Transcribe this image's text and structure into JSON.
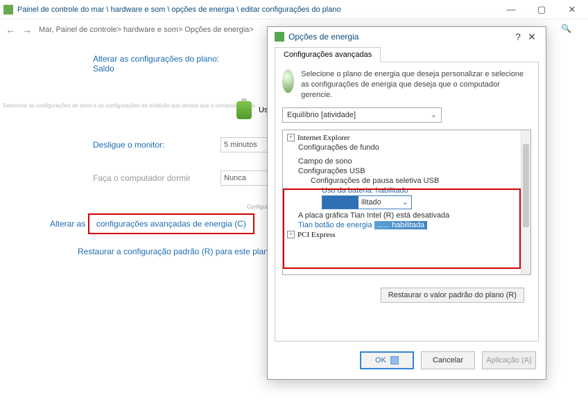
{
  "window": {
    "title": "Painel de controle do mar \\ hardware e som \\ opções de energia \\ editar configurações do plano",
    "minimize": "—",
    "maximize": "▢",
    "close": "✕"
  },
  "toolbar": {
    "back": "←",
    "forward": "→",
    "breadcrumb_prefix": "Mar, Painel de controle> hardware e som> Opções de energia>",
    "search_icon": "🔍"
  },
  "main": {
    "plan_title": "Alterar as configurações do plano: Saldo",
    "faint_desc": "Selecione as configurações de sono e as configurações de exibição que deseja que o computador use.",
    "use_label": "Use",
    "rows": [
      {
        "label": "Desligue o monitor:",
        "value": "5 minutos"
      },
      {
        "label": "Faça o computador dormir",
        "value": "Nunca"
      }
    ],
    "faint_center": "Configurações do adaptador sem fio de campo",
    "adv_link_pre": "Alterar as ",
    "adv_link_box": "configurações avançadas de energia (C)",
    "restore_link": "Restaurar a configuração padrão (R) para este plano"
  },
  "dialog": {
    "title": "Opções de energia",
    "help": "?",
    "close": "✕",
    "tab": "Configurações avançadas",
    "info_text": "Selecione o plano de energia que deseja personalizar e selecione as configurações de energia que deseja que o computador gerencie.",
    "plan_select": "Equilíbrio [atividade]",
    "tree": {
      "ie": "Internet Explorer",
      "fundo": "Configurações de fundo",
      "sono": "Campo de sono",
      "usb_group": "Configurações USB",
      "usb_sel": "Configurações de pausa seletiva USB",
      "uso_bateria": "Uso da bateria: habilitado",
      "dropdown_value": "ilitado",
      "graphics": "A placa gráfica Tian Intel (R) está desativada",
      "tian_btn_pre": "Tian botão de energia ",
      "tian_btn_smear": "...... habilitada",
      "pci": "PCI Express"
    },
    "restore_btn": "Restaurar o valor padrão do plano (R)",
    "buttons": {
      "ok": "OK",
      "cancel": "Cancelar",
      "apply": "Aplicação (A)"
    }
  }
}
